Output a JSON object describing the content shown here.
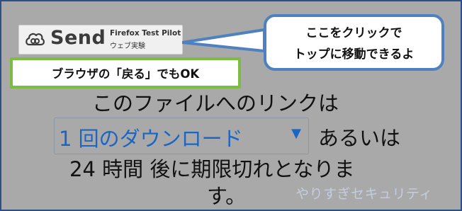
{
  "logo": {
    "name": "Send",
    "product": "Firefox Test Pilot",
    "subtitle": "ウェブ実験"
  },
  "callout": {
    "line1": "ここをクリックで",
    "line2": "トップに移動できるよ",
    "border_color": "#4f81c1"
  },
  "note": {
    "text": "ブラウザの「戻る」でもOK",
    "border_color": "#7cbc41"
  },
  "message": {
    "line1": "このファイルへのリンクは",
    "after_select": "あるいは",
    "line3": "24 時間 後に期限切れとなりま",
    "line4": "す。"
  },
  "download_select": {
    "value": "1 回のダウンロード",
    "arrow": "▼",
    "color": "#1c66c3"
  },
  "watermark": "やりすぎセキュリティ",
  "colors": {
    "background": "#a9a9a9",
    "frame_border": "#2c4f86"
  },
  "icons": [
    "send-logo-icon",
    "dropdown-arrow-icon"
  ]
}
